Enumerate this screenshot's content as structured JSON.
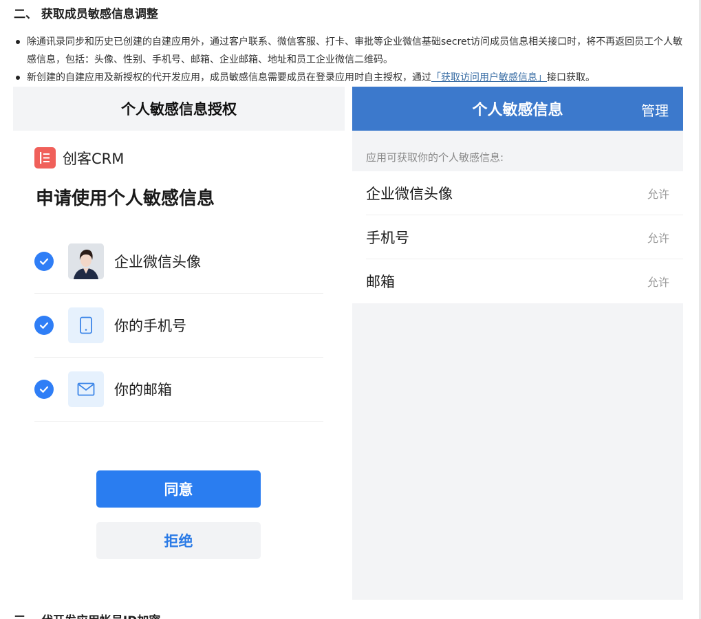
{
  "section_title": "二、 获取成员敏感信息调整",
  "bullets": {
    "b1_text": "除通讯录同步和历史已创建的自建应用外，通过客户联系、微信客服、打卡、审批等企业微信基础secret访问成员信息相关接口时，将不再返回员工个人敏感信息，包括：头像、性别、手机号、邮箱、企业邮箱、地址和员工企业微信二维码。",
    "b2_before": "新创建的自建应用及新授权的代开发应用，成员敏感信息需要成员在登录应用时自主授权，通过",
    "b2_link": "「获取访问用户敏感信息」",
    "b2_after": "接口获取。"
  },
  "left_panel": {
    "header": "个人敏感信息授权",
    "app_name": "创客CRM",
    "apply_title": "申请使用个人敏感信息",
    "permissions": [
      {
        "label": "企业微信头像",
        "icon": "avatar-photo"
      },
      {
        "label": "你的手机号",
        "icon": "phone-icon"
      },
      {
        "label": "你的邮箱",
        "icon": "mail-icon"
      }
    ],
    "agree_label": "同意",
    "reject_label": "拒绝"
  },
  "right_panel": {
    "header": "个人敏感信息",
    "manage": "管理",
    "caption": "应用可获取你的个人敏感信息:",
    "items": [
      {
        "label": "企业微信头像",
        "status": "允许"
      },
      {
        "label": "手机号",
        "status": "允许"
      },
      {
        "label": "邮箱",
        "status": "允许"
      }
    ]
  },
  "next_section": "三、 代开发应用帐号ID加密",
  "colors": {
    "primary_blue": "#2a7df0",
    "header_blue": "#3c79cc",
    "app_logo_red": "#f0605a",
    "link": "#3a6ea5"
  }
}
